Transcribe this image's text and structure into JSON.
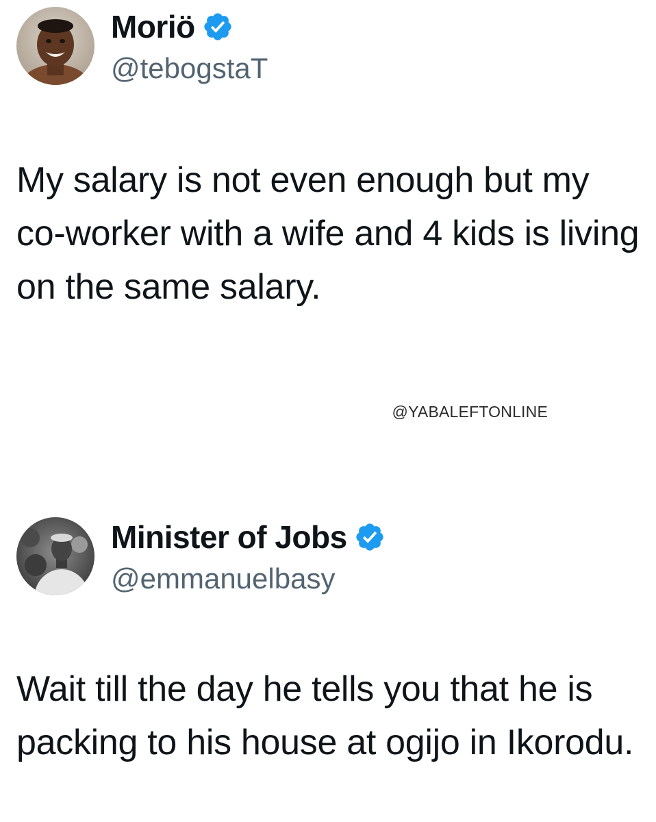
{
  "tweets": [
    {
      "display_name": "Moriö",
      "handle": "@tebogstaT",
      "verified": true,
      "avatar_icon": "profile-photo-icon",
      "text": "My salary is not even enough but my co-worker with a wife and 4 kids is living on the same salary."
    },
    {
      "display_name": "Minister of Jobs",
      "handle": "@emmanuelbasy",
      "verified": true,
      "avatar_icon": "profile-photo-icon",
      "text": "Wait till the day he tells you that he is packing to his house at ogijo in Ikorodu."
    }
  ],
  "watermark": "@YABALEFTONLINE",
  "colors": {
    "verified_blue": "#1d9bf0",
    "handle_gray": "#536471",
    "text": "#0f1419"
  }
}
